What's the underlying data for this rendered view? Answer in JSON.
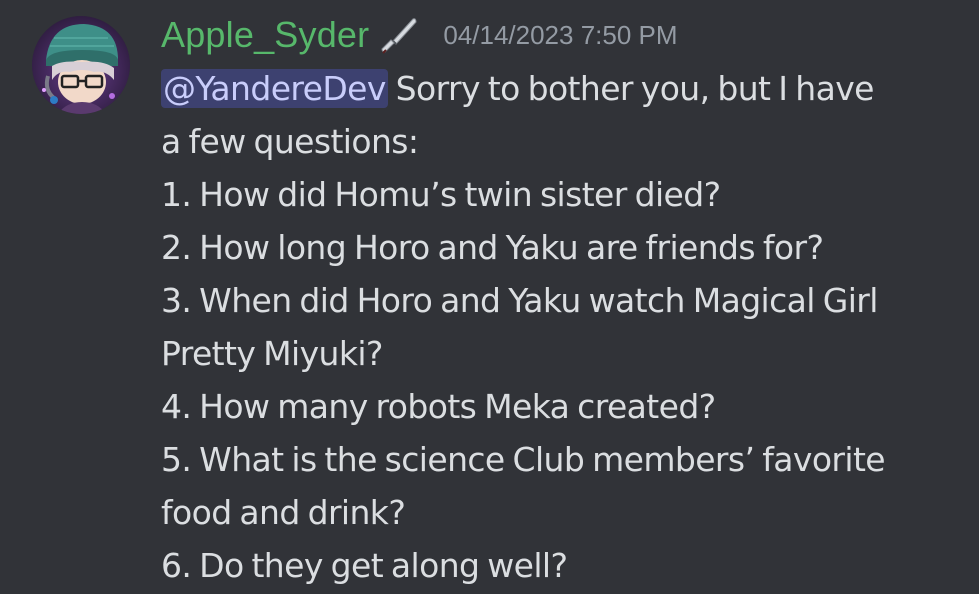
{
  "message": {
    "author": "Apple_Syder",
    "role_icon": "knife-icon",
    "timestamp": "04/14/2023 7:50 PM",
    "mention": "@YandereDev",
    "lines": [
      " Sorry to bother you, but I have",
      "a few questions:",
      "1. How did Homu’s twin sister died?",
      "2. How long Horo and Yaku are friends for?",
      "3. When did Horo and Yaku watch Magical Girl",
      "Pretty Miyuki?",
      "4. How many robots Meka created?",
      "5. What is the science Club members’ favorite",
      "food and drink?",
      "6. Do they get along well?"
    ]
  },
  "colors": {
    "background": "#313338",
    "username": "#57b86b",
    "timestamp": "#949ba4",
    "text": "#dbdee1",
    "mention_bg": "#3c4270",
    "mention_text": "#c9cdfb"
  }
}
